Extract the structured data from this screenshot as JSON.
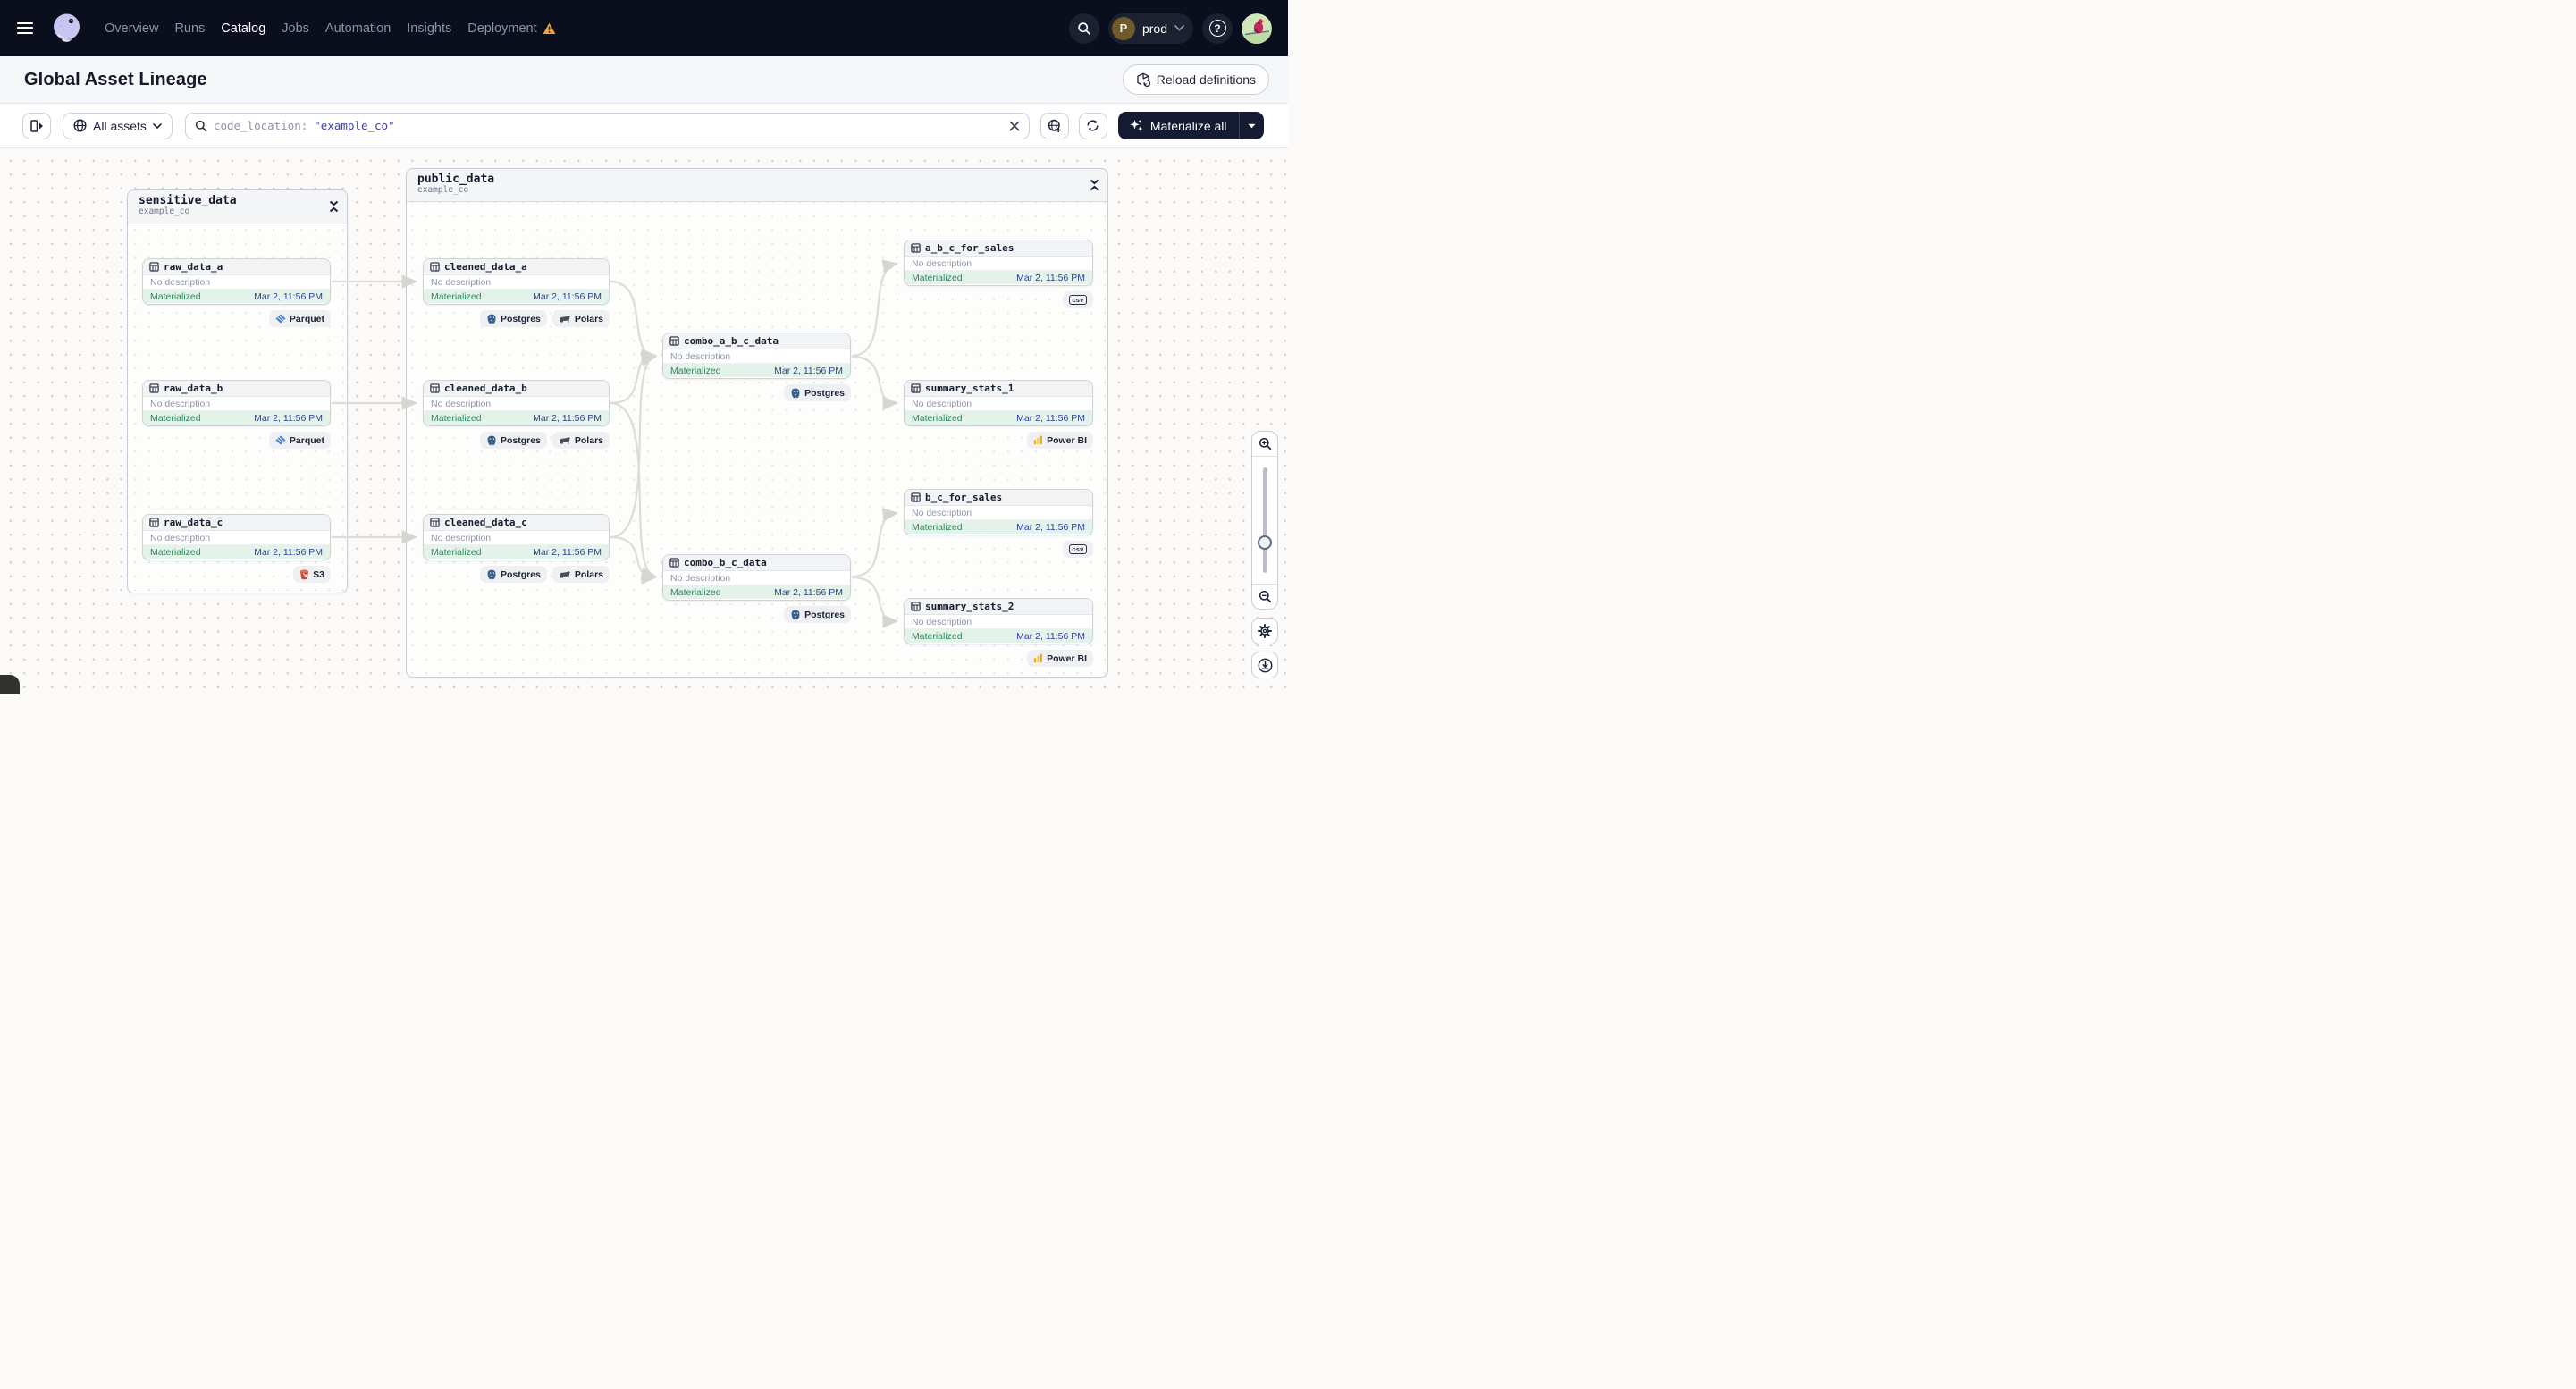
{
  "nav": {
    "menu": [
      "Overview",
      "Runs",
      "Catalog",
      "Jobs",
      "Automation",
      "Insights",
      "Deployment"
    ],
    "active_item": "Catalog",
    "workspace": {
      "initial": "P",
      "name": "prod"
    }
  },
  "header": {
    "title": "Global Asset Lineage",
    "reload_button": "Reload definitions"
  },
  "toolbar": {
    "filter_label": "All assets",
    "search_prefix": "code_location:",
    "search_value": "\"example_co\"",
    "materialize_label": "Materialize all"
  },
  "graph": {
    "groups": [
      {
        "name": "sensitive_data",
        "location": "example_co"
      },
      {
        "name": "public_data",
        "location": "example_co"
      }
    ],
    "nodes": [
      {
        "name": "raw_data_a",
        "description": "No description",
        "status": "Materialized",
        "timestamp": "Mar 2, 11:56 PM",
        "tags": [
          {
            "label": "Parquet",
            "icon": "parquet"
          }
        ]
      },
      {
        "name": "raw_data_b",
        "description": "No description",
        "status": "Materialized",
        "timestamp": "Mar 2, 11:56 PM",
        "tags": [
          {
            "label": "Parquet",
            "icon": "parquet"
          }
        ]
      },
      {
        "name": "raw_data_c",
        "description": "No description",
        "status": "Materialized",
        "timestamp": "Mar 2, 11:56 PM",
        "tags": [
          {
            "label": "S3",
            "icon": "s3"
          }
        ]
      },
      {
        "name": "cleaned_data_a",
        "description": "No description",
        "status": "Materialized",
        "timestamp": "Mar 2, 11:56 PM",
        "tags": [
          {
            "label": "Postgres",
            "icon": "postgres"
          },
          {
            "label": "Polars",
            "icon": "polars"
          }
        ]
      },
      {
        "name": "cleaned_data_b",
        "description": "No description",
        "status": "Materialized",
        "timestamp": "Mar 2, 11:56 PM",
        "tags": [
          {
            "label": "Postgres",
            "icon": "postgres"
          },
          {
            "label": "Polars",
            "icon": "polars"
          }
        ]
      },
      {
        "name": "cleaned_data_c",
        "description": "No description",
        "status": "Materialized",
        "timestamp": "Mar 2, 11:56 PM",
        "tags": [
          {
            "label": "Postgres",
            "icon": "postgres"
          },
          {
            "label": "Polars",
            "icon": "polars"
          }
        ]
      },
      {
        "name": "combo_a_b_c_data",
        "description": "No description",
        "status": "Materialized",
        "timestamp": "Mar 2, 11:56 PM",
        "tags": [
          {
            "label": "Postgres",
            "icon": "postgres"
          }
        ]
      },
      {
        "name": "combo_b_c_data",
        "description": "No description",
        "status": "Materialized",
        "timestamp": "Mar 2, 11:56 PM",
        "tags": [
          {
            "label": "Postgres",
            "icon": "postgres"
          }
        ]
      },
      {
        "name": "a_b_c_for_sales",
        "description": "No description",
        "status": "Materialized",
        "timestamp": "Mar 2, 11:56 PM",
        "badge": "csv"
      },
      {
        "name": "summary_stats_1",
        "description": "No description",
        "status": "Materialized",
        "timestamp": "Mar 2, 11:56 PM",
        "tags": [
          {
            "label": "Power BI",
            "icon": "powerbi"
          }
        ]
      },
      {
        "name": "b_c_for_sales",
        "description": "No description",
        "status": "Materialized",
        "timestamp": "Mar 2, 11:56 PM",
        "badge": "csv"
      },
      {
        "name": "summary_stats_2",
        "description": "No description",
        "status": "Materialized",
        "timestamp": "Mar 2, 11:56 PM",
        "tags": [
          {
            "label": "Power BI",
            "icon": "powerbi"
          }
        ]
      }
    ]
  },
  "colors": {
    "nav_bg": "#0a0e1d",
    "materialized_green": "#2f8a5a",
    "materialized_bg": "#e3f3ea",
    "timestamp_blue": "#333e9b",
    "query_value_indigo": "#3c3f9e",
    "warning_orange": "#f2a33c",
    "accent_dark": "#141b33"
  }
}
